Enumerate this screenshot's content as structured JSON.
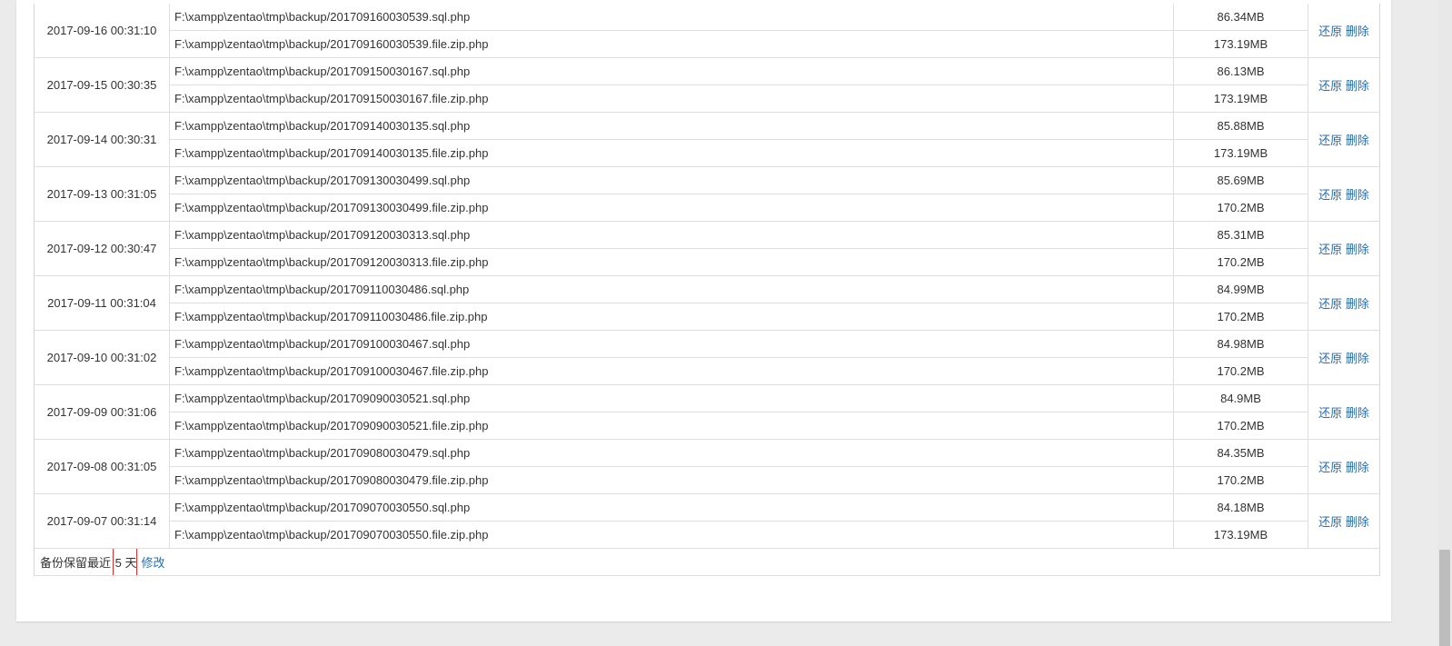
{
  "backups": [
    {
      "time": "2017-09-16 00:31:10",
      "files": [
        {
          "path": "F:\\xampp\\zentao\\tmp\\backup/201709160030539.sql.php",
          "size": "86.34MB"
        },
        {
          "path": "F:\\xampp\\zentao\\tmp\\backup/201709160030539.file.zip.php",
          "size": "173.19MB"
        }
      ],
      "restore": "还原",
      "delete": "删除"
    },
    {
      "time": "2017-09-15 00:30:35",
      "files": [
        {
          "path": "F:\\xampp\\zentao\\tmp\\backup/201709150030167.sql.php",
          "size": "86.13MB"
        },
        {
          "path": "F:\\xampp\\zentao\\tmp\\backup/201709150030167.file.zip.php",
          "size": "173.19MB"
        }
      ],
      "restore": "还原",
      "delete": "删除"
    },
    {
      "time": "2017-09-14 00:30:31",
      "files": [
        {
          "path": "F:\\xampp\\zentao\\tmp\\backup/201709140030135.sql.php",
          "size": "85.88MB"
        },
        {
          "path": "F:\\xampp\\zentao\\tmp\\backup/201709140030135.file.zip.php",
          "size": "173.19MB"
        }
      ],
      "restore": "还原",
      "delete": "删除"
    },
    {
      "time": "2017-09-13 00:31:05",
      "files": [
        {
          "path": "F:\\xampp\\zentao\\tmp\\backup/201709130030499.sql.php",
          "size": "85.69MB"
        },
        {
          "path": "F:\\xampp\\zentao\\tmp\\backup/201709130030499.file.zip.php",
          "size": "170.2MB"
        }
      ],
      "restore": "还原",
      "delete": "删除"
    },
    {
      "time": "2017-09-12 00:30:47",
      "files": [
        {
          "path": "F:\\xampp\\zentao\\tmp\\backup/201709120030313.sql.php",
          "size": "85.31MB"
        },
        {
          "path": "F:\\xampp\\zentao\\tmp\\backup/201709120030313.file.zip.php",
          "size": "170.2MB"
        }
      ],
      "restore": "还原",
      "delete": "删除"
    },
    {
      "time": "2017-09-11 00:31:04",
      "files": [
        {
          "path": "F:\\xampp\\zentao\\tmp\\backup/201709110030486.sql.php",
          "size": "84.99MB"
        },
        {
          "path": "F:\\xampp\\zentao\\tmp\\backup/201709110030486.file.zip.php",
          "size": "170.2MB"
        }
      ],
      "restore": "还原",
      "delete": "删除"
    },
    {
      "time": "2017-09-10 00:31:02",
      "files": [
        {
          "path": "F:\\xampp\\zentao\\tmp\\backup/201709100030467.sql.php",
          "size": "84.98MB"
        },
        {
          "path": "F:\\xampp\\zentao\\tmp\\backup/201709100030467.file.zip.php",
          "size": "170.2MB"
        }
      ],
      "restore": "还原",
      "delete": "删除"
    },
    {
      "time": "2017-09-09 00:31:06",
      "files": [
        {
          "path": "F:\\xampp\\zentao\\tmp\\backup/201709090030521.sql.php",
          "size": "84.9MB"
        },
        {
          "path": "F:\\xampp\\zentao\\tmp\\backup/201709090030521.file.zip.php",
          "size": "170.2MB"
        }
      ],
      "restore": "还原",
      "delete": "删除"
    },
    {
      "time": "2017-09-08 00:31:05",
      "files": [
        {
          "path": "F:\\xampp\\zentao\\tmp\\backup/201709080030479.sql.php",
          "size": "84.35MB"
        },
        {
          "path": "F:\\xampp\\zentao\\tmp\\backup/201709080030479.file.zip.php",
          "size": "170.2MB"
        }
      ],
      "restore": "还原",
      "delete": "删除"
    },
    {
      "time": "2017-09-07 00:31:14",
      "files": [
        {
          "path": "F:\\xampp\\zentao\\tmp\\backup/201709070030550.sql.php",
          "size": "84.18MB"
        },
        {
          "path": "F:\\xampp\\zentao\\tmp\\backup/201709070030550.file.zip.php",
          "size": "173.19MB"
        }
      ],
      "restore": "还原",
      "delete": "删除"
    }
  ],
  "footer": {
    "retention_prefix": "备份保留最近",
    "retention_days": "5",
    "retention_unit": "天",
    "edit_label": "修改"
  },
  "colors": {
    "link": "#2b6cb0",
    "highlight_box": "#d9302c"
  }
}
